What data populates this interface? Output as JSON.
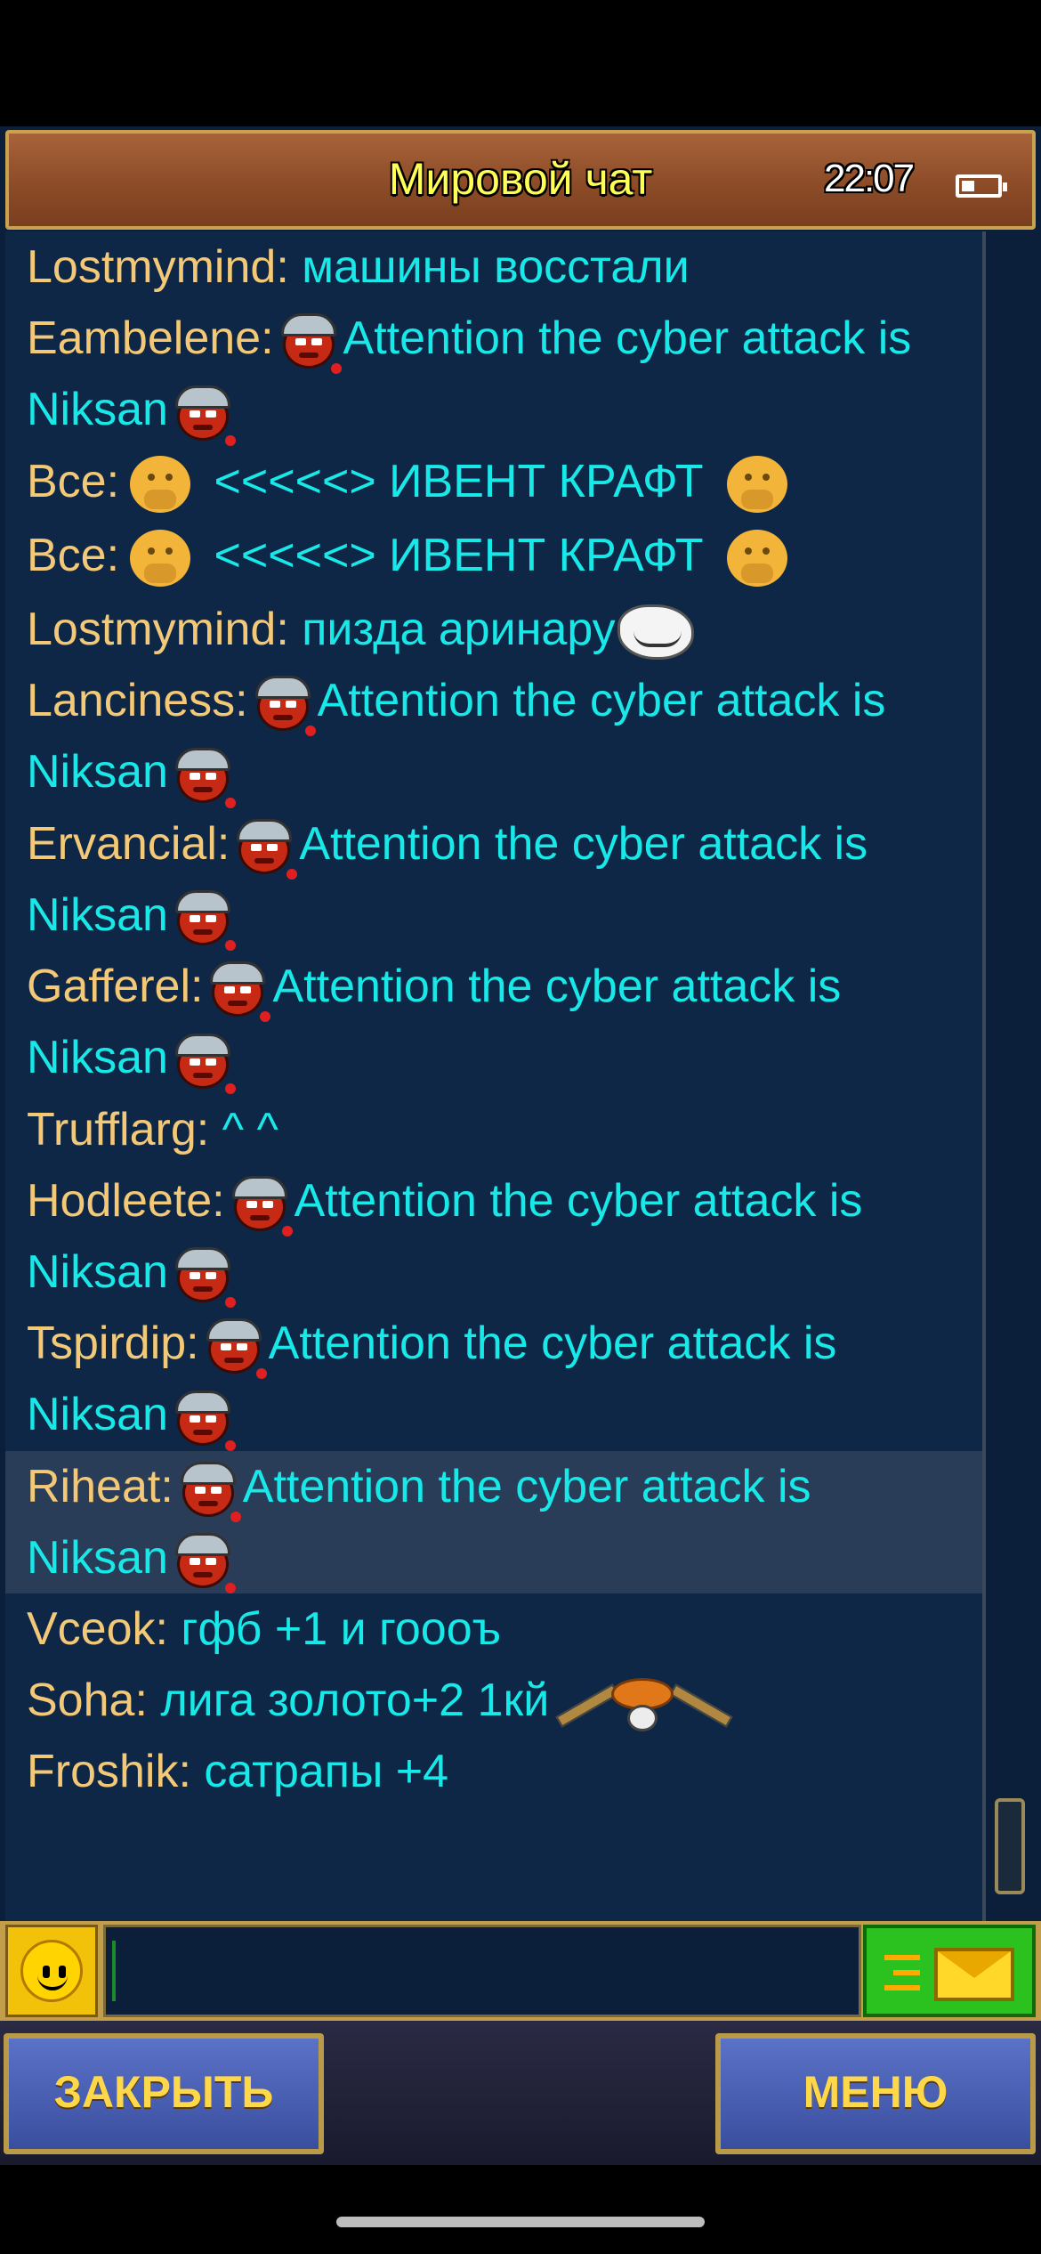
{
  "header": {
    "title": "Мировой чат",
    "clock": "22:07",
    "battery_level": 0.35
  },
  "messages": [
    {
      "user": "Lostmymind:",
      "parts": [
        {
          "t": "text",
          "v": " машины восстали"
        }
      ]
    },
    {
      "user": "Eambelene:",
      "parts": [
        {
          "t": "icon",
          "v": "devil-viking-emoji"
        },
        {
          "t": "text",
          "v": "Attention the cyber attack is Niksan"
        },
        {
          "t": "icon",
          "v": "devil-viking-emoji"
        }
      ]
    },
    {
      "user": "Все:",
      "parts": [
        {
          "t": "icon",
          "v": "shy-smiley-emoji"
        },
        {
          "t": "text",
          "v": " <<<<<> ИВЕНТ КРАФТ "
        },
        {
          "t": "icon",
          "v": "shy-smiley-emoji"
        }
      ]
    },
    {
      "user": "Все:",
      "parts": [
        {
          "t": "icon",
          "v": "shy-smiley-emoji"
        },
        {
          "t": "text",
          "v": " <<<<<> ИВЕНТ КРАФТ "
        },
        {
          "t": "icon",
          "v": "shy-smiley-emoji"
        }
      ]
    },
    {
      "user": "Lostmymind:",
      "parts": [
        {
          "t": "text",
          "v": " пизда аринару"
        },
        {
          "t": "icon",
          "v": "troll-face-emoji"
        }
      ]
    },
    {
      "user": "Lanciness:",
      "parts": [
        {
          "t": "icon",
          "v": "devil-viking-emoji"
        },
        {
          "t": "text",
          "v": "Attention the cyber attack is Niksan"
        },
        {
          "t": "icon",
          "v": "devil-viking-emoji"
        }
      ]
    },
    {
      "user": "Ervancial:",
      "parts": [
        {
          "t": "icon",
          "v": "devil-viking-emoji"
        },
        {
          "t": "text",
          "v": "Attention the cyber attack is Niksan"
        },
        {
          "t": "icon",
          "v": "devil-viking-emoji"
        }
      ]
    },
    {
      "user": "Gafferel:",
      "parts": [
        {
          "t": "icon",
          "v": "devil-viking-emoji"
        },
        {
          "t": "text",
          "v": "Attention the cyber attack is Niksan"
        },
        {
          "t": "icon",
          "v": "devil-viking-emoji"
        }
      ]
    },
    {
      "user": "Trufflarg:",
      "parts": [
        {
          "t": "text",
          "v": " ^     ^"
        }
      ]
    },
    {
      "user": "Hodleete:",
      "parts": [
        {
          "t": "icon",
          "v": "devil-viking-emoji"
        },
        {
          "t": "text",
          "v": "Attention the cyber attack is Niksan"
        },
        {
          "t": "icon",
          "v": "devil-viking-emoji"
        }
      ]
    },
    {
      "user": "Tspirdip:",
      "parts": [
        {
          "t": "icon",
          "v": "devil-viking-emoji"
        },
        {
          "t": "text",
          "v": "Attention the cyber attack is Niksan"
        },
        {
          "t": "icon",
          "v": "devil-viking-emoji"
        }
      ]
    },
    {
      "user": "Riheat:",
      "highlight": true,
      "parts": [
        {
          "t": "icon",
          "v": "devil-viking-emoji"
        },
        {
          "t": "text",
          "v": "Attention the cyber attack is Niksan"
        },
        {
          "t": "icon",
          "v": "devil-viking-emoji"
        }
      ]
    },
    {
      "user": "Vceok:",
      "parts": [
        {
          "t": "text",
          "v": " гфб +1 и гоооъ"
        }
      ]
    },
    {
      "user": "Soha:",
      "parts": [
        {
          "t": "text",
          "v": " лига золото+2 1кй"
        },
        {
          "t": "icon",
          "v": "sombrero-skull-emoji"
        }
      ]
    },
    {
      "user": "Froshik:",
      "parts": [
        {
          "t": "text",
          "v": " сатрапы +4"
        }
      ]
    }
  ],
  "input": {
    "placeholder": "",
    "value": ""
  },
  "icons": {
    "emoji_button": "smiley-face-icon",
    "send_button": "envelope-send-icon"
  },
  "buttons": {
    "close": "ЗАКРЫТЬ",
    "menu": "МЕНЮ"
  },
  "colors": {
    "username": "#f3c978",
    "message_text": "#18e8e8",
    "title": "#ffff55",
    "button_text": "#ffd84a"
  }
}
